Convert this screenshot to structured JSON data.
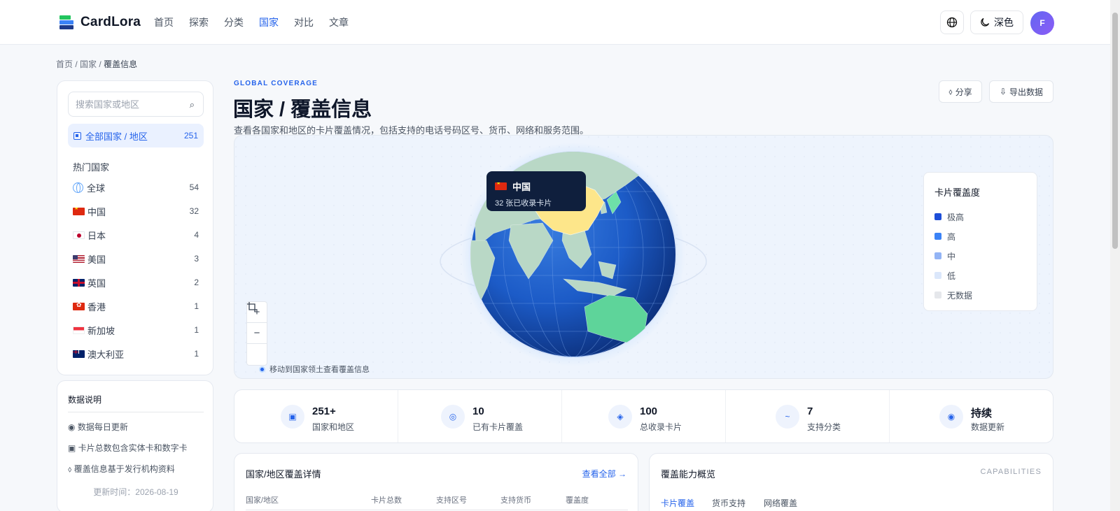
{
  "header": {
    "brand": "CardLora",
    "nav": [
      "首页",
      "探索",
      "分类",
      "国家",
      "对比",
      "文章"
    ],
    "active_nav": "国家",
    "theme_label": "深色",
    "avatar_initial": "F"
  },
  "breadcrumb": {
    "items": [
      "首页",
      "国家"
    ],
    "current": "覆盖信息",
    "separator": "/"
  },
  "sidebar": {
    "search_placeholder": "搜索国家或地区",
    "all": {
      "label": "全部国家 / 地区",
      "count": "251"
    },
    "hot_title": "热门国家",
    "countries": [
      {
        "name": "全球",
        "count": "54",
        "flag": "globe-icon"
      },
      {
        "name": "中国",
        "count": "32",
        "flag": "cn"
      },
      {
        "name": "日本",
        "count": "4",
        "flag": "jp"
      },
      {
        "name": "美国",
        "count": "3",
        "flag": "us"
      },
      {
        "name": "英国",
        "count": "2",
        "flag": "gb"
      },
      {
        "name": "香港",
        "count": "1",
        "flag": "hk"
      },
      {
        "name": "新加坡",
        "count": "1",
        "flag": "sg"
      },
      {
        "name": "澳大利亚",
        "count": "1",
        "flag": "au"
      }
    ]
  },
  "info": {
    "title": "数据说明",
    "items": [
      "数据每日更新",
      "卡片总数包含实体卡和数字卡",
      "覆盖信息基于发行机构资料"
    ],
    "updated": "更新时间：2026-08-19"
  },
  "page": {
    "eyebrow": "GLOBAL COVERAGE",
    "title": "国家 / 覆盖信息",
    "subtitle": "查看各国家和地区的卡片覆盖情况，包括支持的电话号码区号、货币、网络和服务范围。",
    "share_label": "分享",
    "export_label": "导出数据"
  },
  "map": {
    "tooltip": {
      "country": "中国",
      "text": "32 张已收录卡片"
    },
    "legend_title": "卡片覆盖度",
    "legend": [
      {
        "label": "极高",
        "color": "#1d4ed8"
      },
      {
        "label": "高",
        "color": "#3b82f6"
      },
      {
        "label": "中",
        "color": "#93b4f5"
      },
      {
        "label": "低",
        "color": "#dbe7fb"
      },
      {
        "label": "无数据",
        "color": "#e5e7eb"
      }
    ],
    "highlight_color": "#fde68a",
    "zoom_in": "+",
    "zoom_out": "−",
    "hint": "移动到国家领土查看覆盖信息"
  },
  "stats": [
    {
      "value": "251+",
      "label": "国家和地区",
      "icon": "square-icon"
    },
    {
      "value": "10",
      "label": "已有卡片覆盖",
      "icon": "target-icon"
    },
    {
      "value": "100",
      "label": "总收录卡片",
      "icon": "diamond-icon"
    },
    {
      "value": "7",
      "label": "支持分类",
      "icon": "wave-icon"
    },
    {
      "value": "持续",
      "label": "数据更新",
      "icon": "radio-icon"
    }
  ],
  "coverage_table": {
    "title": "国家/地区覆盖详情",
    "view_all": "查看全部 →",
    "columns": [
      "国家/地区",
      "卡片总数",
      "支持区号",
      "支持货币",
      "覆盖度"
    ]
  },
  "capabilities": {
    "title": "覆盖能力概览",
    "tag": "CAPABILITIES",
    "tabs": [
      "卡片覆盖",
      "货币支持",
      "网络覆盖"
    ]
  }
}
